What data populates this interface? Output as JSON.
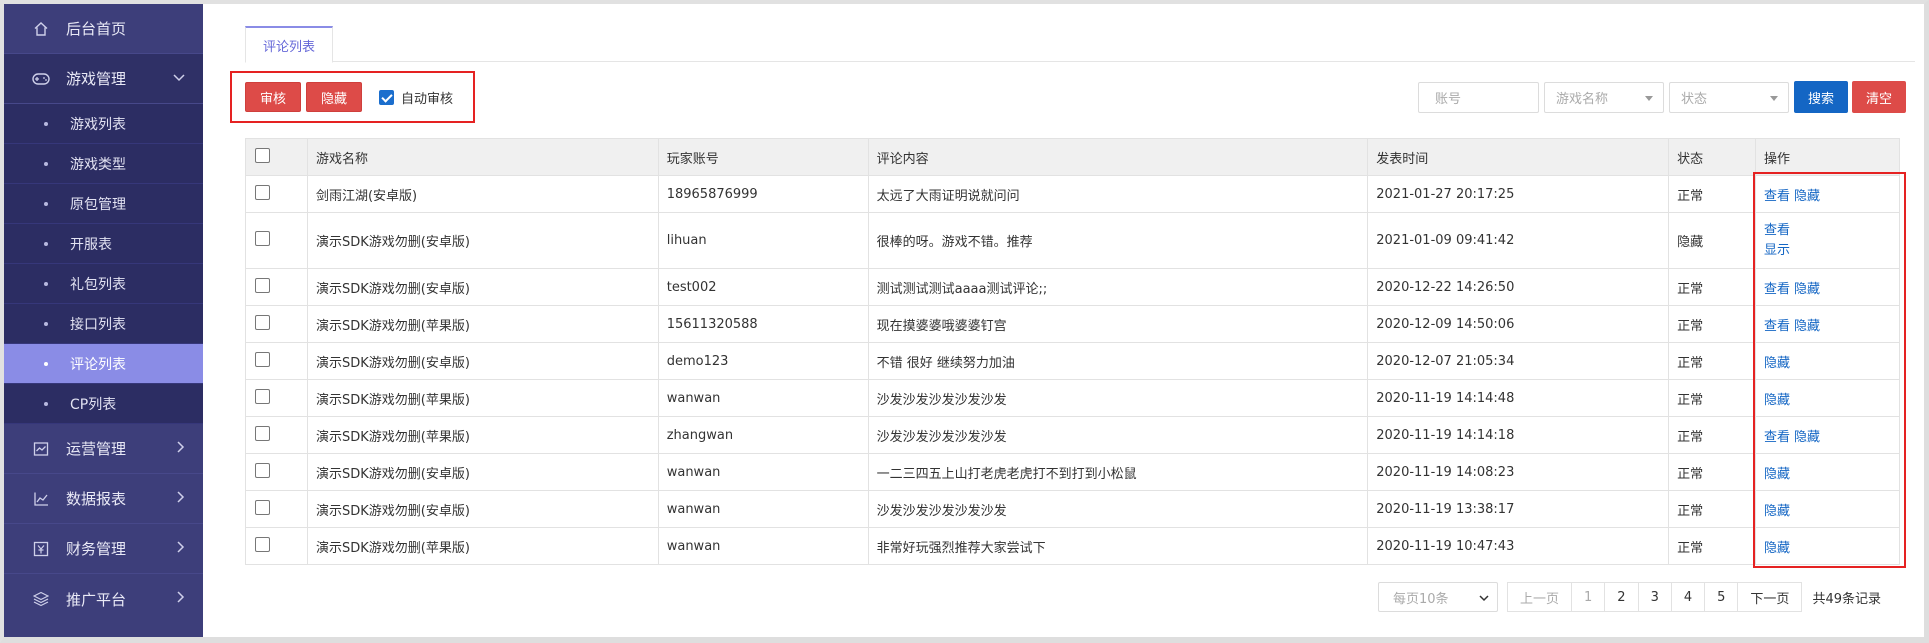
{
  "sidebar": {
    "home": "后台首页",
    "game_mgmt": "游戏管理",
    "sub_items": [
      "游戏列表",
      "游戏类型",
      "原包管理",
      "开服表",
      "礼包列表",
      "接口列表",
      "评论列表",
      "CP列表"
    ],
    "active_sub": "评论列表",
    "bottom_items": [
      "运营管理",
      "数据报表",
      "财务管理",
      "推广平台"
    ]
  },
  "tab": {
    "label": "评论列表"
  },
  "toolbar": {
    "approve_label": "审核",
    "hide_label": "隐藏",
    "auto_approve_label": "自动审核",
    "auto_approve_checked": true
  },
  "filters": {
    "account_placeholder": "账号",
    "game_name_placeholder": "游戏名称",
    "status_placeholder": "状态",
    "search_label": "搜索",
    "clear_label": "清空"
  },
  "table": {
    "headers": [
      "游戏名称",
      "玩家账号",
      "评论内容",
      "发表时间",
      "状态",
      "操作"
    ],
    "rows": [
      {
        "game": "剑雨江湖(安卓版)",
        "account": "18965876999",
        "content": "太远了大雨证明说就问问",
        "time": "2021-01-27 20:17:25",
        "status": "正常",
        "ops": [
          "查看",
          "隐藏"
        ],
        "stack": false
      },
      {
        "game": "演示SDK游戏勿删(安卓版)",
        "account": "lihuan",
        "content": "很棒的呀。游戏不错。推荐",
        "time": "2021-01-09 09:41:42",
        "status": "隐藏",
        "ops": [
          "查看",
          "显示"
        ],
        "stack": true
      },
      {
        "game": "演示SDK游戏勿删(安卓版)",
        "account": "test002",
        "content": "测试测试测试aaaa测试评论;;",
        "time": "2020-12-22 14:26:50",
        "status": "正常",
        "ops": [
          "查看",
          "隐藏"
        ],
        "stack": false
      },
      {
        "game": "演示SDK游戏勿删(苹果版)",
        "account": "15611320588",
        "content": "现在摸婆婆哦婆婆钉宫",
        "time": "2020-12-09 14:50:06",
        "status": "正常",
        "ops": [
          "查看",
          "隐藏"
        ],
        "stack": false
      },
      {
        "game": "演示SDK游戏勿删(安卓版)",
        "account": "demo123",
        "content": "不错 很好 继续努力加油",
        "time": "2020-12-07 21:05:34",
        "status": "正常",
        "ops": [
          "隐藏"
        ],
        "stack": false
      },
      {
        "game": "演示SDK游戏勿删(苹果版)",
        "account": "wanwan",
        "content": "沙发沙发沙发沙发沙发",
        "time": "2020-11-19 14:14:48",
        "status": "正常",
        "ops": [
          "隐藏"
        ],
        "stack": false
      },
      {
        "game": "演示SDK游戏勿删(苹果版)",
        "account": "zhangwan",
        "content": "沙发沙发沙发沙发沙发",
        "time": "2020-11-19 14:14:18",
        "status": "正常",
        "ops": [
          "查看",
          "隐藏"
        ],
        "stack": false
      },
      {
        "game": "演示SDK游戏勿删(安卓版)",
        "account": "wanwan",
        "content": "一二三四五上山打老虎老虎打不到打到小松鼠",
        "time": "2020-11-19 14:08:23",
        "status": "正常",
        "ops": [
          "隐藏"
        ],
        "stack": false
      },
      {
        "game": "演示SDK游戏勿删(安卓版)",
        "account": "wanwan",
        "content": "沙发沙发沙发沙发沙发",
        "time": "2020-11-19 13:38:17",
        "status": "正常",
        "ops": [
          "隐藏"
        ],
        "stack": false
      },
      {
        "game": "演示SDK游戏勿删(苹果版)",
        "account": "wanwan",
        "content": "非常好玩强烈推荐大家尝试下",
        "time": "2020-11-19 10:47:43",
        "status": "正常",
        "ops": [
          "隐藏"
        ],
        "stack": false
      }
    ]
  },
  "pagination": {
    "per_page": "每页10条",
    "prev": "上一页",
    "pages": [
      "1",
      "2",
      "3",
      "4",
      "5"
    ],
    "next": "下一页",
    "total": "共49条记录"
  },
  "colors": {
    "sidebar_bg": "#3d3e7a",
    "sidebar_active": "#8a8ce6",
    "danger": "#dd4b48",
    "primary": "#1466c4",
    "highlight_border": "#e52222"
  }
}
